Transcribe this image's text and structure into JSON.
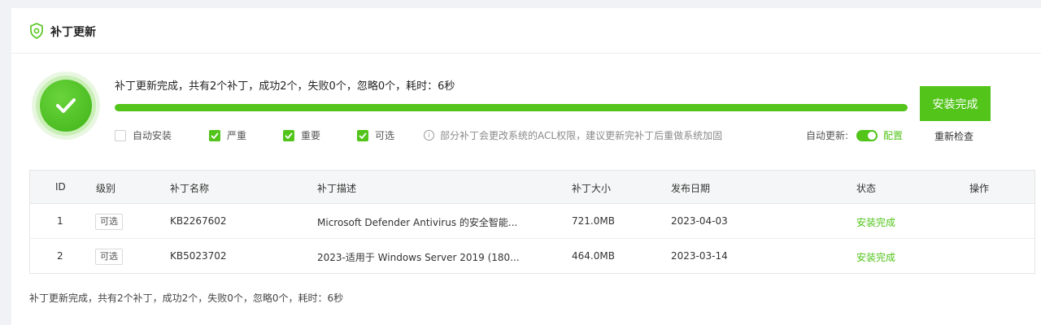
{
  "header": {
    "title": "补丁更新",
    "icon": "shield-icon"
  },
  "status": {
    "icon": "checkmark-icon",
    "state": "complete"
  },
  "summary": "补丁更新完成，共有2个补丁，成功2个，失败0个，忽略0个，耗时：6秒",
  "progress": {
    "percent": 100
  },
  "install_button": "安装完成",
  "options": [
    {
      "label": "自动安装",
      "checked": false
    },
    {
      "label": "严重",
      "checked": true
    },
    {
      "label": "重要",
      "checked": true
    },
    {
      "label": "可选",
      "checked": true
    }
  ],
  "hint": "部分补丁会更改系统的ACL权限，建议更新完补丁后重做系统加固",
  "auto_update": {
    "label": "自动更新:",
    "enabled": true,
    "config_label": "配置"
  },
  "recheck_label": "重新检查",
  "table": {
    "columns": [
      "ID",
      "级别",
      "补丁名称",
      "补丁描述",
      "补丁大小",
      "发布日期",
      "状态",
      "操作"
    ],
    "rows": [
      {
        "id": "1",
        "level": "可选",
        "name": "KB2267602",
        "desc": "Microsoft Defender Antivirus 的安全智能...",
        "size": "721.0MB",
        "date": "2023-04-03",
        "status": "安装完成"
      },
      {
        "id": "2",
        "level": "可选",
        "name": "KB5023702",
        "desc": "2023-适用于 Windows Server 2019 (180...",
        "size": "464.0MB",
        "date": "2023-03-14",
        "status": "安装完成"
      }
    ]
  },
  "footer": "补丁更新完成，共有2个补丁，成功2个，失败0个，忽略0个，耗时：6秒",
  "colors": {
    "accent": "#52c41a",
    "background": "#f0f2f5"
  }
}
